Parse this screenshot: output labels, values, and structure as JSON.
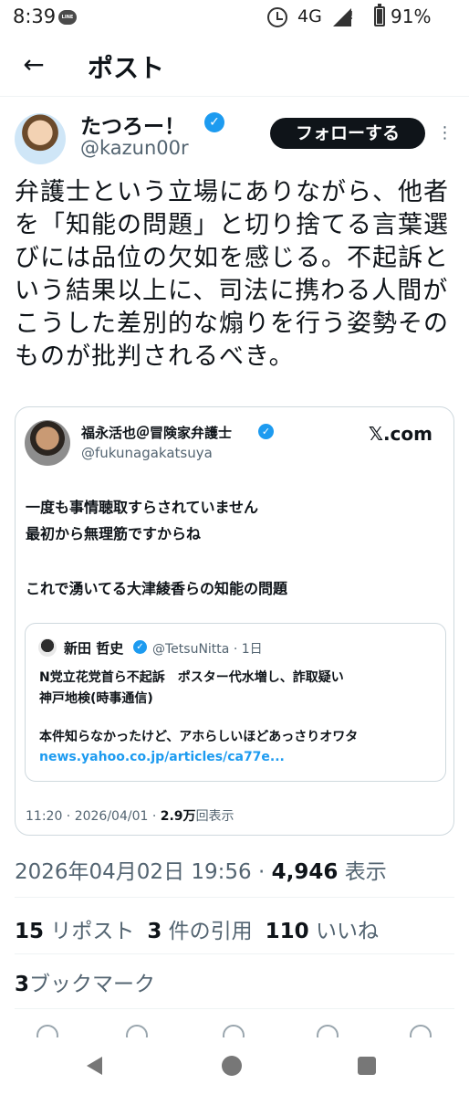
{
  "status_bar": {
    "time": "8:39",
    "app_icon": "LINE",
    "network": "4G",
    "battery": "91%"
  },
  "topbar": {
    "title": "ポスト"
  },
  "post": {
    "author_name": "たつろー！",
    "author_handle": "@kazun00r",
    "follow_label": "フォローする",
    "text": "弁護士という立場にありながら、他者を「知能の問題」と切り捨てる言葉選びには品位の欠如を感じる。不起訴という結果以上に、司法に携わる人間がこうした差別的な煽りを行う姿勢そのものが批判されるべき。",
    "date": "2026年04月02日 19:56",
    "views_count": "4,946",
    "views_label": "表示"
  },
  "quoted": {
    "author_name": "福永活也＠冒険家弁護士",
    "author_handle": "@fukunagakatsuya",
    "source": "𝕏.com",
    "line1": "一度も事情聴取すらされていません",
    "line2": "最初から無理筋ですからね",
    "line3": "これで湧いてる大津綾香らの知能の問題",
    "inner": {
      "author_name": "新田 哲史",
      "meta": "@TetsuNitta · 1日",
      "line1": "N党立花党首ら不起訴　ポスター代水増し、詐取疑い",
      "line2": "神戸地検(時事通信)",
      "line3": "本件知らなかったけど、アホらしいほどあっさりオワタ",
      "link": "news.yahoo.co.jp/articles/ca77e..."
    },
    "footer_time": "11:20 · 2026/04/01 · ",
    "footer_views": "2.9万",
    "footer_views_label": "回表示"
  },
  "stats": {
    "reposts_count": "15",
    "reposts_label": "リポスト",
    "quotes_count": "3",
    "quotes_label": "件の引用",
    "likes_count": "110",
    "likes_label": "いいね",
    "bookmarks_count": "3",
    "bookmarks_label": "ブックマーク"
  },
  "colors": {
    "accent": "#1d9bf0",
    "text": "#0f1419",
    "secondary": "#536471",
    "border": "#cfd9de"
  }
}
